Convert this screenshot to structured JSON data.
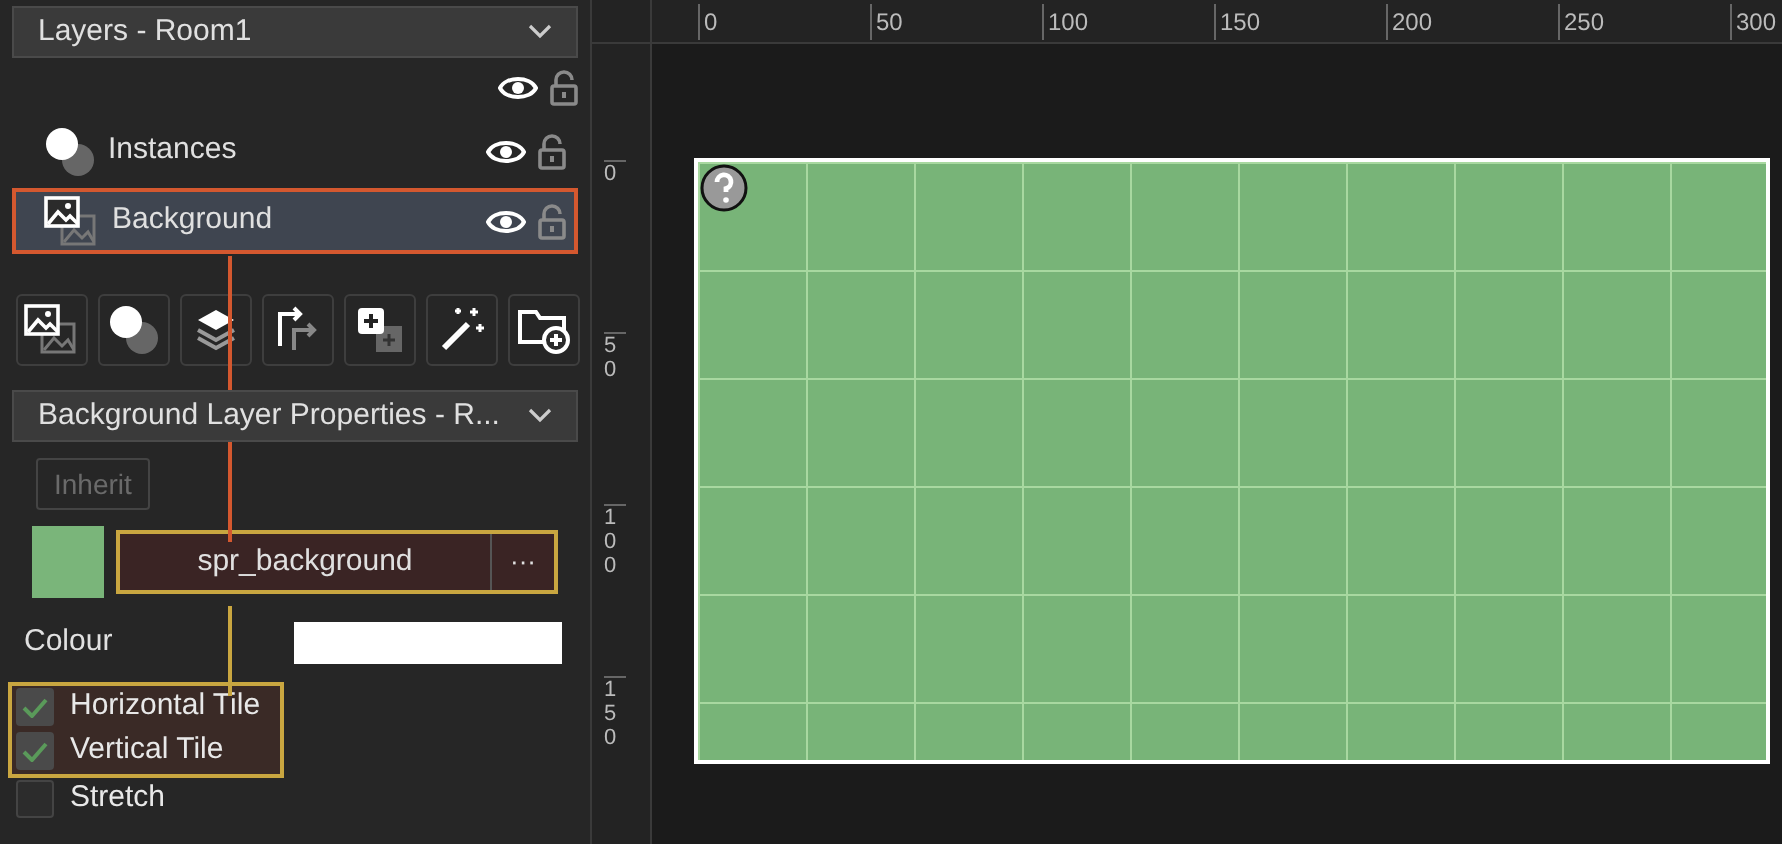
{
  "layers_panel": {
    "title": "Layers - Room1",
    "layers": [
      {
        "name": "Instances",
        "kind": "instances",
        "selected": false,
        "highlighted": false
      },
      {
        "name": "Background",
        "kind": "background",
        "selected": true,
        "highlighted": true
      }
    ]
  },
  "properties": {
    "title": "Background Layer Properties - R...",
    "inherit_button": "Inherit",
    "inherit_disabled": true,
    "sprite": "spr_background",
    "sprite_highlighted": true,
    "browse_button": "···",
    "colour_label": "Colour",
    "options": [
      {
        "label": "Horizontal Tile",
        "checked": true,
        "highlighted": true
      },
      {
        "label": "Vertical Tile",
        "checked": true,
        "highlighted": true
      },
      {
        "label": "Stretch",
        "checked": false,
        "highlighted": false
      }
    ]
  },
  "canvas": {
    "x_ruler": [
      "0",
      "50",
      "100",
      "150",
      "200",
      "250",
      "300"
    ],
    "y_ruler": [
      "0",
      "50",
      "100",
      "150"
    ]
  }
}
